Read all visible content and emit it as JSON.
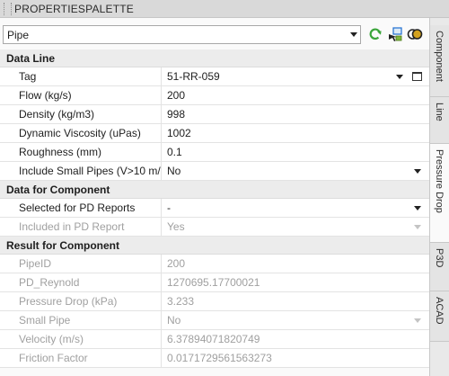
{
  "titlebar": {
    "title": "PROPERTIESPALETTE"
  },
  "toolbar": {
    "selector_value": "Pipe",
    "icons": [
      "refresh-icon",
      "select-objects-icon",
      "toggle-view-icon"
    ]
  },
  "sections": [
    {
      "title": "Data Line",
      "rows": [
        {
          "label": "Tag",
          "value": "51-RR-059",
          "dropdown": true,
          "button": true,
          "disabled": false
        },
        {
          "label": "Flow (kg/s)",
          "value": "200",
          "dropdown": false,
          "disabled": false
        },
        {
          "label": "Density (kg/m3)",
          "value": "998",
          "dropdown": false,
          "disabled": false
        },
        {
          "label": "Dynamic Viscosity (uPas)",
          "value": "1002",
          "dropdown": false,
          "disabled": false
        },
        {
          "label": "Roughness (mm)",
          "value": "0.1",
          "dropdown": false,
          "disabled": false
        },
        {
          "label": "Include Small Pipes (V>10 m/s)",
          "value": "No",
          "dropdown": true,
          "disabled": false
        }
      ]
    },
    {
      "title": "Data for Component",
      "rows": [
        {
          "label": "Selected for PD Reports",
          "value": "-",
          "dropdown": true,
          "disabled": false
        },
        {
          "label": "Included in PD Report",
          "value": "Yes",
          "dropdown": true,
          "disabled": true
        }
      ]
    },
    {
      "title": "Result for Component",
      "rows": [
        {
          "label": "PipeID",
          "value": "200",
          "dropdown": false,
          "disabled": true
        },
        {
          "label": "PD_Reynold",
          "value": "1270695.17700021",
          "dropdown": false,
          "disabled": true
        },
        {
          "label": "Pressure Drop (kPa)",
          "value": "3.233",
          "dropdown": false,
          "disabled": true
        },
        {
          "label": "Small Pipe",
          "value": "No",
          "dropdown": true,
          "disabled": true
        },
        {
          "label": "Velocity (m/s)",
          "value": "6.37894071820749",
          "dropdown": false,
          "disabled": true
        },
        {
          "label": "Friction Factor",
          "value": "0.0171729561563273",
          "dropdown": false,
          "disabled": true
        }
      ]
    }
  ],
  "side_tabs": [
    {
      "label": "Component",
      "active": false
    },
    {
      "label": "Line",
      "active": false
    },
    {
      "label": "Pressure Drop",
      "active": true
    },
    {
      "label": "P3D",
      "active": false
    },
    {
      "label": "ACAD",
      "active": false
    }
  ],
  "colors": {
    "refresh": "#3aa53a",
    "accent": "#1e6fd0",
    "disabled_text": "#a0a0a0"
  }
}
